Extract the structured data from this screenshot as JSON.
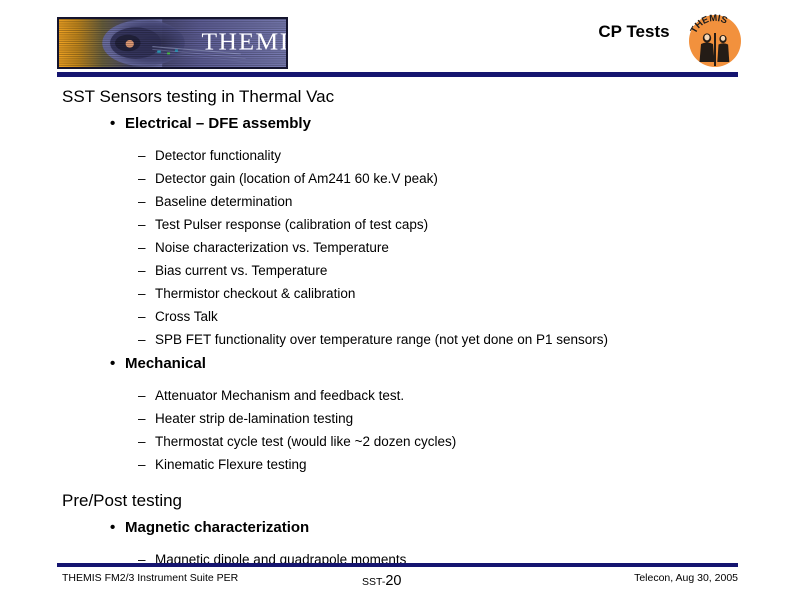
{
  "header": {
    "title": "CP Tests",
    "logo_text": "THEMIS",
    "logo_alt_name": "themis-magnetosphere-banner",
    "patch_text": "THEMIS",
    "rule_color": "#151570"
  },
  "slide": {
    "sections": [
      {
        "heading": "SST Sensors testing in Thermal Vac",
        "groups": [
          {
            "label": "Electrical – DFE assembly",
            "marker": "•",
            "items": [
              {
                "marker": "–",
                "text": "Detector functionality"
              },
              {
                "marker": "–",
                "text": "Detector gain (location of Am241 60 ke.V peak)"
              },
              {
                "marker": "–",
                "text": "Baseline determination"
              },
              {
                "marker": "–",
                "text": "Test Pulser response (calibration of test caps)"
              },
              {
                "marker": "–",
                "text": "Noise characterization vs. Temperature"
              },
              {
                "marker": "–",
                "text": "Bias current vs. Temperature"
              },
              {
                "marker": "–",
                "text": "Thermistor checkout & calibration"
              },
              {
                "marker": "–",
                "text": "Cross Talk"
              },
              {
                "marker": "–",
                "text": "SPB FET functionality over temperature range (not yet done on P1 sensors)"
              }
            ]
          },
          {
            "label": "Mechanical",
            "marker": "•",
            "items": [
              {
                "marker": "–",
                "text": "Attenuator Mechanism and feedback test."
              },
              {
                "marker": "–",
                "text": "Heater strip de-lamination testing"
              },
              {
                "marker": "–",
                "text": "Thermostat cycle test (would like ~2 dozen cycles)"
              },
              {
                "marker": "–",
                "text": "Kinematic Flexure testing"
              }
            ]
          }
        ]
      },
      {
        "heading": "Pre/Post testing",
        "groups": [
          {
            "label": "Magnetic characterization",
            "marker": "•",
            "items": [
              {
                "marker": "–",
                "text": "Magnetic dipole and quadrapole moments"
              }
            ]
          }
        ]
      }
    ]
  },
  "footer": {
    "left": "THEMIS FM2/3 Instrument Suite PER",
    "center_prefix": "SST-",
    "center_number": "20",
    "right": "Telecon, Aug 30, 2005",
    "rule_color": "#151570"
  }
}
